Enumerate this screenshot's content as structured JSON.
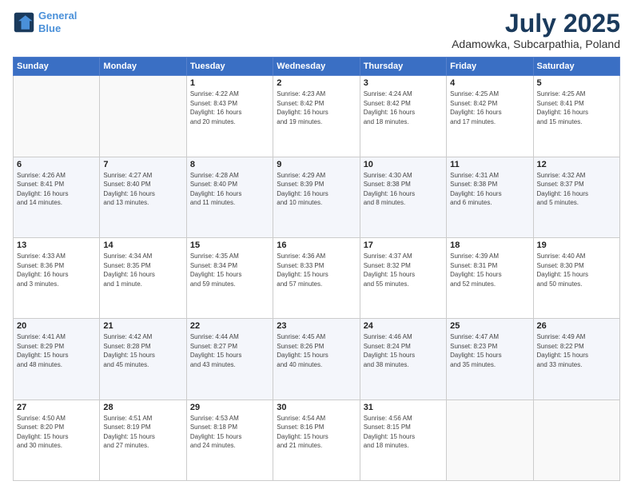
{
  "logo": {
    "line1": "General",
    "line2": "Blue"
  },
  "title": "July 2025",
  "subtitle": "Adamowka, Subcarpathia, Poland",
  "days_header": [
    "Sunday",
    "Monday",
    "Tuesday",
    "Wednesday",
    "Thursday",
    "Friday",
    "Saturday"
  ],
  "weeks": [
    [
      {
        "num": "",
        "info": ""
      },
      {
        "num": "",
        "info": ""
      },
      {
        "num": "1",
        "info": "Sunrise: 4:22 AM\nSunset: 8:43 PM\nDaylight: 16 hours\nand 20 minutes."
      },
      {
        "num": "2",
        "info": "Sunrise: 4:23 AM\nSunset: 8:42 PM\nDaylight: 16 hours\nand 19 minutes."
      },
      {
        "num": "3",
        "info": "Sunrise: 4:24 AM\nSunset: 8:42 PM\nDaylight: 16 hours\nand 18 minutes."
      },
      {
        "num": "4",
        "info": "Sunrise: 4:25 AM\nSunset: 8:42 PM\nDaylight: 16 hours\nand 17 minutes."
      },
      {
        "num": "5",
        "info": "Sunrise: 4:25 AM\nSunset: 8:41 PM\nDaylight: 16 hours\nand 15 minutes."
      }
    ],
    [
      {
        "num": "6",
        "info": "Sunrise: 4:26 AM\nSunset: 8:41 PM\nDaylight: 16 hours\nand 14 minutes."
      },
      {
        "num": "7",
        "info": "Sunrise: 4:27 AM\nSunset: 8:40 PM\nDaylight: 16 hours\nand 13 minutes."
      },
      {
        "num": "8",
        "info": "Sunrise: 4:28 AM\nSunset: 8:40 PM\nDaylight: 16 hours\nand 11 minutes."
      },
      {
        "num": "9",
        "info": "Sunrise: 4:29 AM\nSunset: 8:39 PM\nDaylight: 16 hours\nand 10 minutes."
      },
      {
        "num": "10",
        "info": "Sunrise: 4:30 AM\nSunset: 8:38 PM\nDaylight: 16 hours\nand 8 minutes."
      },
      {
        "num": "11",
        "info": "Sunrise: 4:31 AM\nSunset: 8:38 PM\nDaylight: 16 hours\nand 6 minutes."
      },
      {
        "num": "12",
        "info": "Sunrise: 4:32 AM\nSunset: 8:37 PM\nDaylight: 16 hours\nand 5 minutes."
      }
    ],
    [
      {
        "num": "13",
        "info": "Sunrise: 4:33 AM\nSunset: 8:36 PM\nDaylight: 16 hours\nand 3 minutes."
      },
      {
        "num": "14",
        "info": "Sunrise: 4:34 AM\nSunset: 8:35 PM\nDaylight: 16 hours\nand 1 minute."
      },
      {
        "num": "15",
        "info": "Sunrise: 4:35 AM\nSunset: 8:34 PM\nDaylight: 15 hours\nand 59 minutes."
      },
      {
        "num": "16",
        "info": "Sunrise: 4:36 AM\nSunset: 8:33 PM\nDaylight: 15 hours\nand 57 minutes."
      },
      {
        "num": "17",
        "info": "Sunrise: 4:37 AM\nSunset: 8:32 PM\nDaylight: 15 hours\nand 55 minutes."
      },
      {
        "num": "18",
        "info": "Sunrise: 4:39 AM\nSunset: 8:31 PM\nDaylight: 15 hours\nand 52 minutes."
      },
      {
        "num": "19",
        "info": "Sunrise: 4:40 AM\nSunset: 8:30 PM\nDaylight: 15 hours\nand 50 minutes."
      }
    ],
    [
      {
        "num": "20",
        "info": "Sunrise: 4:41 AM\nSunset: 8:29 PM\nDaylight: 15 hours\nand 48 minutes."
      },
      {
        "num": "21",
        "info": "Sunrise: 4:42 AM\nSunset: 8:28 PM\nDaylight: 15 hours\nand 45 minutes."
      },
      {
        "num": "22",
        "info": "Sunrise: 4:44 AM\nSunset: 8:27 PM\nDaylight: 15 hours\nand 43 minutes."
      },
      {
        "num": "23",
        "info": "Sunrise: 4:45 AM\nSunset: 8:26 PM\nDaylight: 15 hours\nand 40 minutes."
      },
      {
        "num": "24",
        "info": "Sunrise: 4:46 AM\nSunset: 8:24 PM\nDaylight: 15 hours\nand 38 minutes."
      },
      {
        "num": "25",
        "info": "Sunrise: 4:47 AM\nSunset: 8:23 PM\nDaylight: 15 hours\nand 35 minutes."
      },
      {
        "num": "26",
        "info": "Sunrise: 4:49 AM\nSunset: 8:22 PM\nDaylight: 15 hours\nand 33 minutes."
      }
    ],
    [
      {
        "num": "27",
        "info": "Sunrise: 4:50 AM\nSunset: 8:20 PM\nDaylight: 15 hours\nand 30 minutes."
      },
      {
        "num": "28",
        "info": "Sunrise: 4:51 AM\nSunset: 8:19 PM\nDaylight: 15 hours\nand 27 minutes."
      },
      {
        "num": "29",
        "info": "Sunrise: 4:53 AM\nSunset: 8:18 PM\nDaylight: 15 hours\nand 24 minutes."
      },
      {
        "num": "30",
        "info": "Sunrise: 4:54 AM\nSunset: 8:16 PM\nDaylight: 15 hours\nand 21 minutes."
      },
      {
        "num": "31",
        "info": "Sunrise: 4:56 AM\nSunset: 8:15 PM\nDaylight: 15 hours\nand 18 minutes."
      },
      {
        "num": "",
        "info": ""
      },
      {
        "num": "",
        "info": ""
      }
    ]
  ]
}
